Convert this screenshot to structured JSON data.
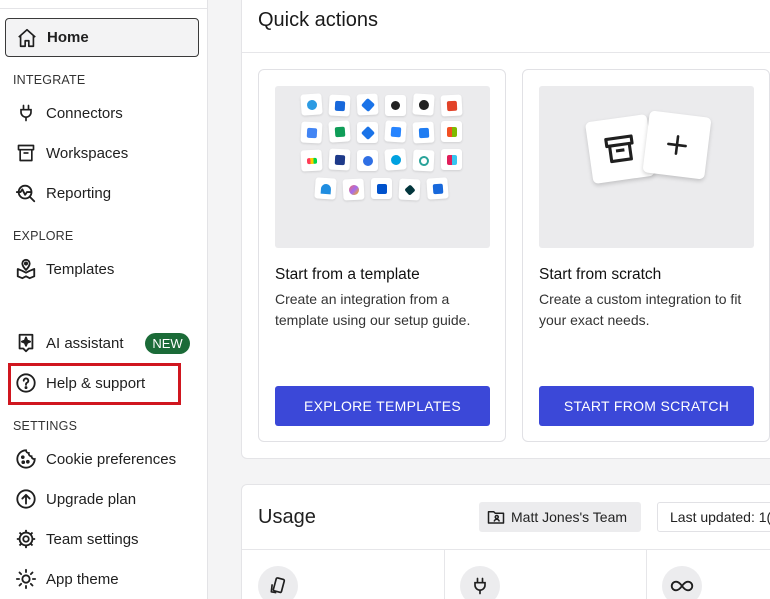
{
  "sidebar": {
    "home": {
      "label": "Home",
      "icon": "home-icon"
    },
    "sections": {
      "integrate": "INTEGRATE",
      "explore": "EXPLORE",
      "settings": "SETTINGS"
    },
    "integrate_items": [
      {
        "label": "Connectors",
        "icon": "plug-icon"
      },
      {
        "label": "Workspaces",
        "icon": "archive-box-icon"
      },
      {
        "label": "Reporting",
        "icon": "search-activity-icon"
      }
    ],
    "explore_items": [
      {
        "label": "Templates",
        "icon": "map-pin-icon"
      }
    ],
    "ai_assistant": {
      "label": "AI assistant",
      "icon": "sparkle-icon",
      "badge": "NEW"
    },
    "help": {
      "label": "Help & support",
      "icon": "question-circle-icon"
    },
    "settings_items": [
      {
        "label": "Cookie preferences",
        "icon": "cookie-icon"
      },
      {
        "label": "Upgrade plan",
        "icon": "arrow-up-circle-icon"
      },
      {
        "label": "Team settings",
        "icon": "gear-icon"
      },
      {
        "label": "App theme",
        "icon": "sun-icon"
      }
    ]
  },
  "quick_actions": {
    "title": "Quick actions",
    "template_card": {
      "title": "Start from a template",
      "description": "Create an integration from a template using our setup guide.",
      "button": "EXPLORE TEMPLATES"
    },
    "scratch_card": {
      "title": "Start from scratch",
      "description": "Create a custom integration to fit your exact needs.",
      "button": "START FROM SCRATCH"
    }
  },
  "usage": {
    "title": "Usage",
    "team": "Matt Jones's Team",
    "last_updated": "Last updated: 1("
  },
  "colors": {
    "primary_button": "#3b48d8",
    "badge_green": "#1b6b38",
    "highlight_red": "#d0161f"
  }
}
